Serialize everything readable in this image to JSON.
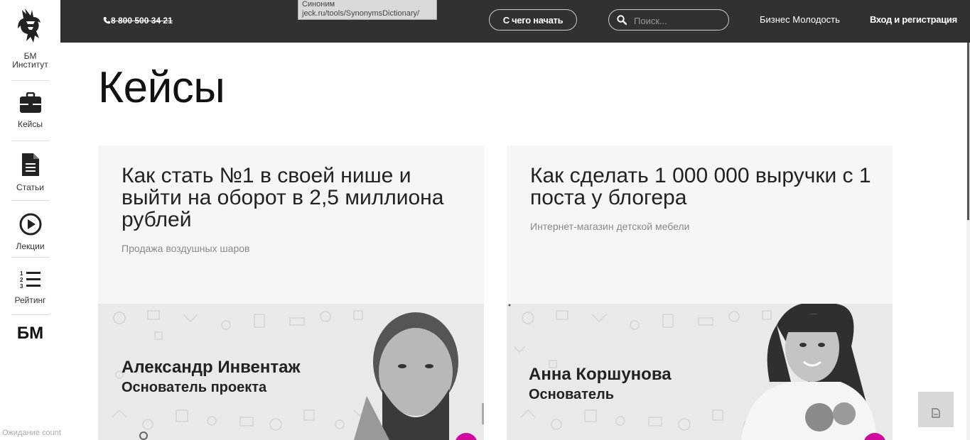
{
  "sidebar": {
    "logo_label": "БМ\nИнститут",
    "items": [
      {
        "label": "Кейсы",
        "icon": "briefcase-icon"
      },
      {
        "label": "Статьи",
        "icon": "document-icon"
      },
      {
        "label": "Лекции",
        "icon": "play-icon"
      },
      {
        "label": "Рейтинг",
        "icon": "ranked-list-icon"
      }
    ],
    "bm_text": "БМ"
  },
  "status_bar": "Ожидание count",
  "topbar": {
    "phone": "8 800 500 34 21",
    "tooltip_line1": "Синоним",
    "tooltip_line2": "jeck.ru/tools/SynonymsDictionary/",
    "start_button": "С чего начать",
    "search_placeholder": "Поиск...",
    "link_business": "Бизнес Молодость",
    "link_login": "Вход и регистрация"
  },
  "main": {
    "title": "Кейсы",
    "cards": [
      {
        "title": "Как стать №1 в своей нише и выйти на оборот в 2,5 миллиона рублей",
        "subtitle": "Продажа воздушных шаров",
        "person_name": "Александр Инвентаж",
        "person_role": "Основатель проекта"
      },
      {
        "title": "Как сделать 1 000 000 выручки с 1 поста у блогера",
        "subtitle": "Интернет-магазин детской мебели",
        "person_name": "Анна Коршунова",
        "person_role": "Основатель"
      }
    ]
  },
  "colors": {
    "topbar_bg": "#313131",
    "accent_pink": "#d10a9e",
    "card_bg": "#f6f6f6"
  }
}
